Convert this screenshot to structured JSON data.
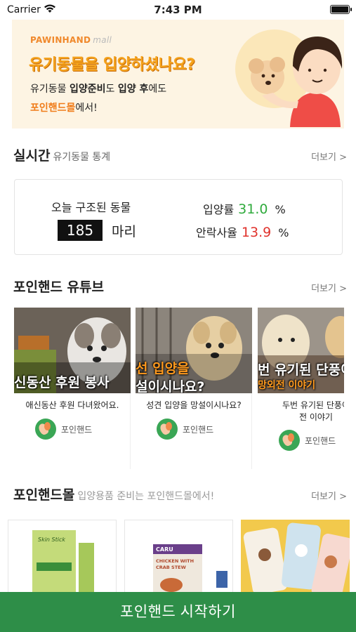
{
  "status_bar": {
    "carrier": "Carrier",
    "time": "7:43 PM"
  },
  "banner": {
    "brand": "PAWINHAND",
    "brand_suffix": "mall",
    "headline": "유기동물을 입양하셨나요?",
    "line1_a": "유기동물 ",
    "line1_b": "입양준비",
    "line1_c": "도 ",
    "line1_d": "입양 후",
    "line1_e": "에도",
    "line2_accent": "포인핸드몰",
    "line2_rest": "에서!"
  },
  "stats_section": {
    "title": "실시간",
    "subtitle": "유기동물 통계",
    "more": "더보기 >",
    "rescued_label": "오늘 구조된 동물",
    "rescued_count": "185",
    "rescued_unit": "마리",
    "adoption_label": "입양률",
    "adoption_value": "31.0",
    "euthanasia_label": "안락사율",
    "euthanasia_value": "13.9",
    "percent": "%"
  },
  "youtube_section": {
    "title": "포인핸드 유튜브",
    "more": "더보기 >",
    "videos": [
      {
        "thumb_text": "신동산 후원 봉사",
        "caption": "애신동산 후원 다녀왔어요.",
        "channel": "포인핸드"
      },
      {
        "thumb_text_a": "선 입양을",
        "thumb_text_b": "설이시나요?",
        "caption": "성견 입양을 망설이시나요?",
        "channel": "포인핸드"
      },
      {
        "thumb_text_a": "번 유기된 단풍이",
        "thumb_text_b": "망외전 이야기",
        "caption_l1": "두번 유기된 단풍이",
        "caption_l2": "전 이야기",
        "channel": "포인핸드"
      }
    ]
  },
  "mall_section": {
    "title": "포인핸드몰",
    "subtitle": "입양용품 준비는 포인핸드몰에서!",
    "more": "더보기 >",
    "products": [
      {
        "label_a": "Skin Stick"
      },
      {
        "brand": "CARU",
        "name_a": "CHICKEN WITH",
        "name_b": "CRAB STEW"
      },
      {
        "name": "pet phone cases"
      }
    ]
  },
  "cta": {
    "label": "포인핸드 시작하기"
  },
  "colors": {
    "brand_green": "#2e8e48",
    "adoption_green": "#2faa3c",
    "euthanasia_red": "#e0322c",
    "banner_bg": "#fdf4e3",
    "accent_orange": "#f5a31c"
  }
}
